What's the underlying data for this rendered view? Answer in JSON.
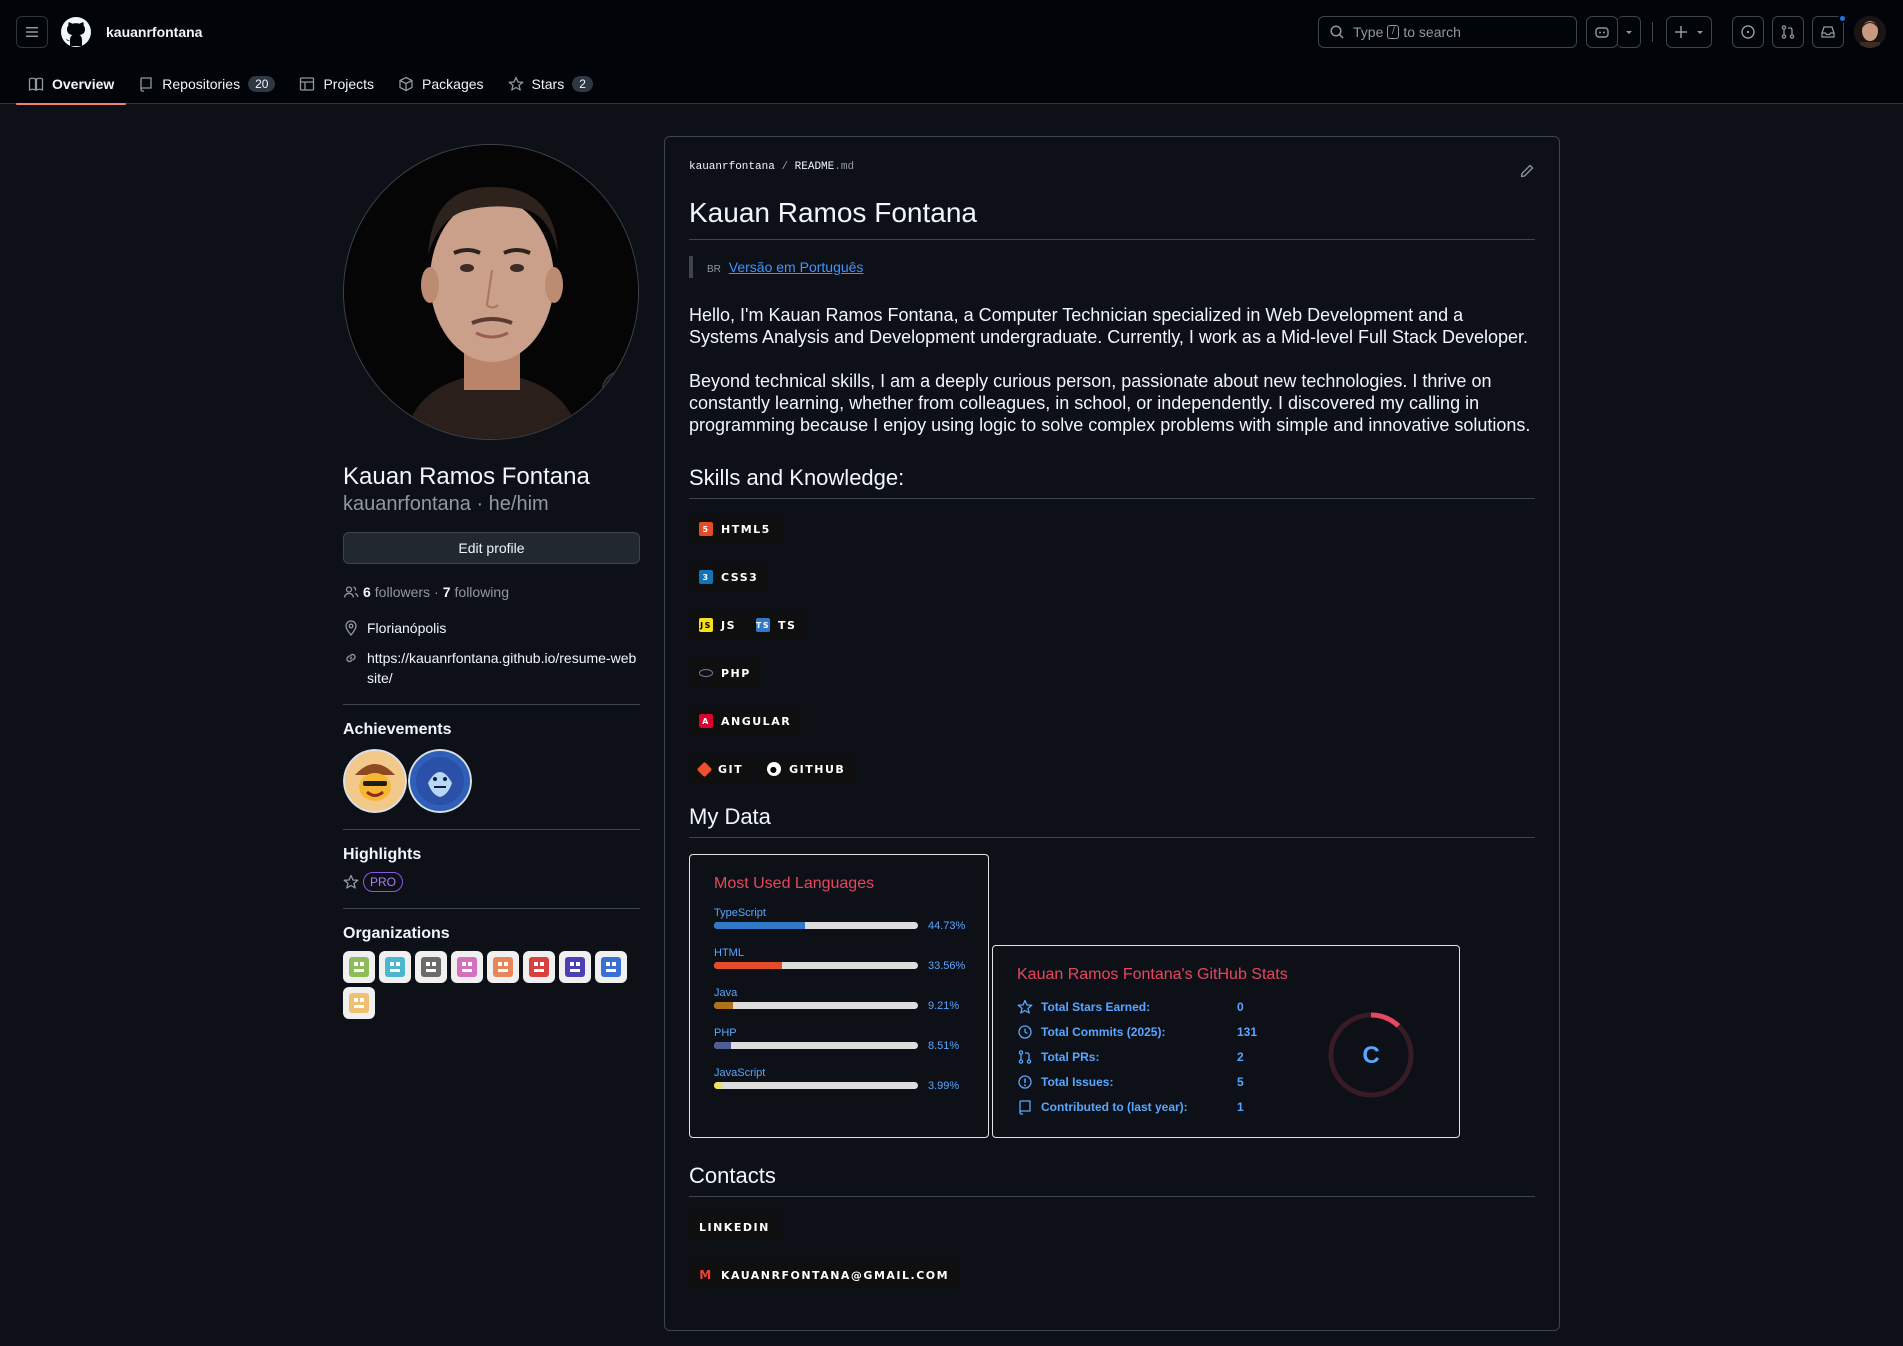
{
  "header": {
    "username": "kauanrfontana",
    "search_placeholder_prefix": "Type",
    "search_kbd": "/",
    "search_placeholder_suffix": "to search"
  },
  "tabs": [
    {
      "label": "Overview",
      "icon": "book-icon",
      "active": true
    },
    {
      "label": "Repositories",
      "icon": "repo-icon",
      "count": "20"
    },
    {
      "label": "Projects",
      "icon": "table-icon"
    },
    {
      "label": "Packages",
      "icon": "package-icon"
    },
    {
      "label": "Stars",
      "icon": "star-icon",
      "count": "2"
    }
  ],
  "profile": {
    "name": "Kauan Ramos Fontana",
    "handle": "kauanrfontana · he/him",
    "edit_label": "Edit profile",
    "followers": "6",
    "followers_label": "followers",
    "following": "7",
    "following_label": "following",
    "dot": "·",
    "location": "Florianópolis",
    "website": "https://kauanrfontana.github.io/resume-website/",
    "achievements_title": "Achievements",
    "highlights_title": "Highlights",
    "pro_label": "PRO",
    "organizations_title": "Organizations",
    "org_colors": [
      "#8fbc5a",
      "#4ab6d0",
      "#6b6b6b",
      "#d56fbe",
      "#e8865a",
      "#d94040",
      "#4b3fb5",
      "#3a6fd8",
      "#f0c070"
    ]
  },
  "readme": {
    "path_user": "kauanrfontana",
    "path_sep": "/",
    "path_file": "README",
    "path_ext": ".md",
    "title": "Kauan Ramos Fontana",
    "flag": "BR",
    "pt_link": "Versão em Português",
    "para1": "Hello, I'm Kauan Ramos Fontana, a Computer Technician specialized in Web Development and a Systems Analysis and Development undergraduate. Currently, I work as a Mid-level Full Stack Developer.",
    "para2": "Beyond technical skills, I am a deeply curious person, passionate about new technologies. I thrive on constantly learning, whether from colleagues, in school, or independently. I discovered my calling in programming because I enjoy using logic to solve complex problems with simple and innovative solutions.",
    "skills_title": "Skills and Knowledge:",
    "skills": {
      "html": "HTML5",
      "css": "CSS3",
      "js": "JS",
      "ts": "TS",
      "php": "PHP",
      "angular": "ANGULAR",
      "git": "GIT",
      "github": "GITHUB"
    },
    "mydata_title": "My Data",
    "contacts_title": "Contacts",
    "linkedin": "LINKEDIN",
    "email": "KAUANRFONTANA@GMAIL.COM"
  },
  "languages_card": {
    "title": "Most Used Languages",
    "items": [
      {
        "name": "TypeScript",
        "percent": 44.73,
        "label": "44.73%",
        "color": "#3178c6"
      },
      {
        "name": "HTML",
        "percent": 33.56,
        "label": "33.56%",
        "color": "#e34c26"
      },
      {
        "name": "Java",
        "percent": 9.21,
        "label": "9.21%",
        "color": "#b07219"
      },
      {
        "name": "PHP",
        "percent": 8.51,
        "label": "8.51%",
        "color": "#4F5D95"
      },
      {
        "name": "JavaScript",
        "percent": 3.99,
        "label": "3.99%",
        "color": "#f1e05a"
      }
    ]
  },
  "stats_card": {
    "title": "Kauan Ramos Fontana's GitHub Stats",
    "rows": [
      {
        "label": "Total Stars Earned:",
        "value": "0",
        "icon": "star-icon"
      },
      {
        "label": "Total Commits (2025):",
        "value": "131",
        "icon": "history-icon"
      },
      {
        "label": "Total PRs:",
        "value": "2",
        "icon": "pull-request-icon"
      },
      {
        "label": "Total Issues:",
        "value": "5",
        "icon": "issue-icon"
      },
      {
        "label": "Contributed to (last year):",
        "value": "1",
        "icon": "repo-icon"
      }
    ],
    "rank": "C",
    "rank_progress": 0.12
  }
}
